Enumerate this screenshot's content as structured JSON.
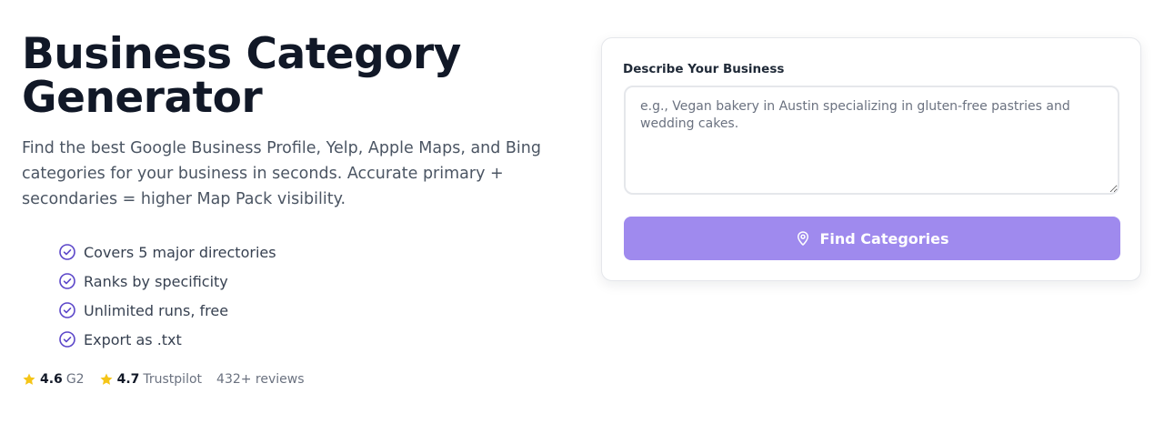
{
  "hero": {
    "title": "Business Category Generator",
    "subtitle": "Find the best Google Business Profile, Yelp, Apple Maps, and Bing categories for your business in seconds. Accurate primary + secondaries = higher Map Pack visibility."
  },
  "features": [
    {
      "label": "Covers 5 major directories",
      "icon": "check-circle-icon"
    },
    {
      "label": "Ranks by specificity",
      "icon": "check-circle-icon"
    },
    {
      "label": "Unlimited runs, free",
      "icon": "check-circle-icon"
    },
    {
      "label": "Export as .txt",
      "icon": "check-circle-icon"
    }
  ],
  "ratings": [
    {
      "score": "4.6",
      "source": "G2",
      "icon": "star-icon"
    },
    {
      "score": "4.7",
      "source": "Trustpilot",
      "icon": "star-icon"
    }
  ],
  "reviews_text": "432+ reviews",
  "form": {
    "label": "Describe Your Business",
    "value": "",
    "placeholder": "e.g., Vegan bakery in Austin specializing in gluten-free pastries and wedding cakes.",
    "button_label": "Find Categories",
    "button_icon": "map-pin-icon"
  },
  "colors": {
    "accent": "#9f8aee",
    "check": "#5b46c9",
    "star": "#f5c518",
    "heading": "#111827",
    "body_text": "#4b5563"
  }
}
